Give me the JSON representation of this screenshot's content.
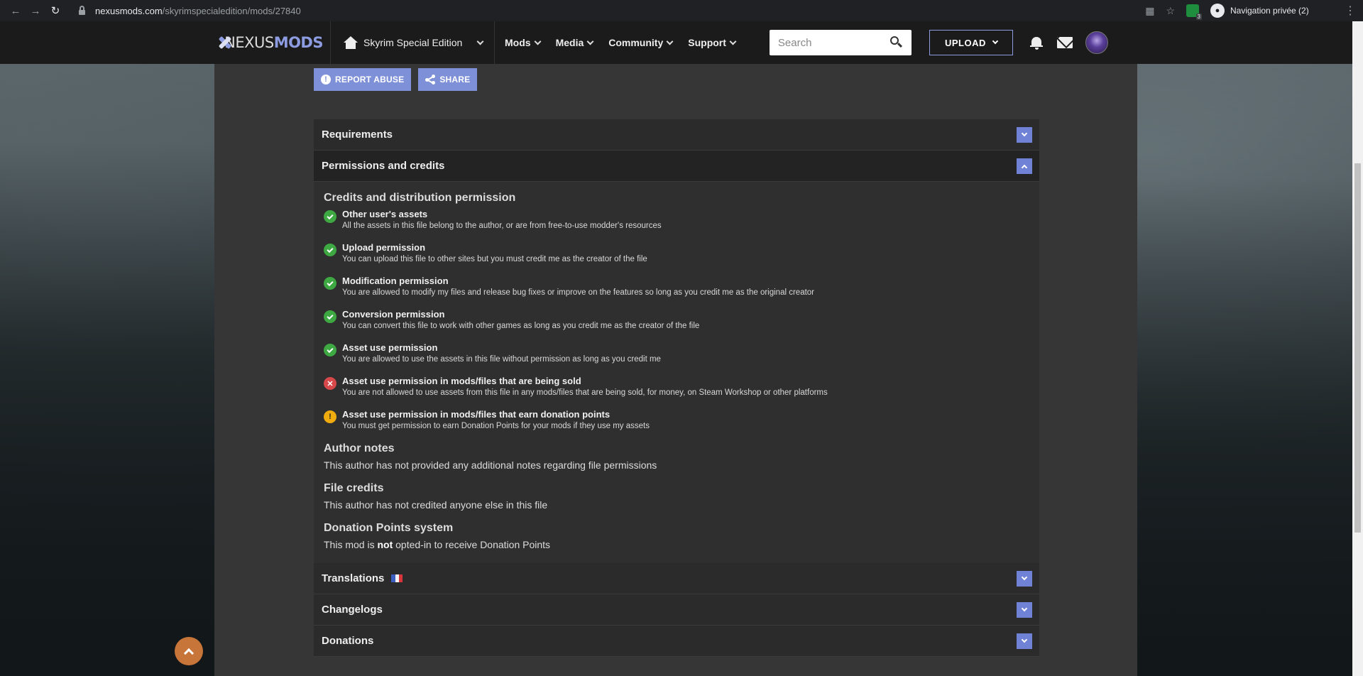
{
  "browser": {
    "url_domain": "nexusmods.com",
    "url_path": "/skyrimspecialedition/mods/27840",
    "extension_badge": "3",
    "profile_label": "Navigation privée (2)"
  },
  "header": {
    "logo_prefix": "NEXUS",
    "logo_suffix": "MODS",
    "game": "Skyrim Special Edition",
    "nav": [
      "Mods",
      "Media",
      "Community",
      "Support"
    ],
    "search_placeholder": "Search",
    "upload_label": "UPLOAD"
  },
  "actions": {
    "report": "REPORT ABUSE",
    "share": "SHARE"
  },
  "tabs": {
    "requirements": "Requirements",
    "permissions": "Permissions and credits",
    "translations": "Translations",
    "changelogs": "Changelogs",
    "donations": "Donations"
  },
  "permissions": {
    "heading": "Credits and distribution permission",
    "items": [
      {
        "status": "ok",
        "title": "Other user's assets",
        "desc": "All the assets in this file belong to the author, or are from free-to-use modder's resources"
      },
      {
        "status": "ok",
        "title": "Upload permission",
        "desc": "You can upload this file to other sites but you must credit me as the creator of the file"
      },
      {
        "status": "ok",
        "title": "Modification permission",
        "desc": "You are allowed to modify my files and release bug fixes or improve on the features so long as you credit me as the original creator"
      },
      {
        "status": "ok",
        "title": "Conversion permission",
        "desc": "You can convert this file to work with other games as long as you credit me as the creator of the file"
      },
      {
        "status": "ok",
        "title": "Asset use permission",
        "desc": "You are allowed to use the assets in this file without permission as long as you credit me"
      },
      {
        "status": "no",
        "title": "Asset use permission in mods/files that are being sold",
        "desc": "You are not allowed to use assets from this file in any mods/files that are being sold, for money, on Steam Workshop or other platforms"
      },
      {
        "status": "warn",
        "title": "Asset use permission in mods/files that earn donation points",
        "desc": "You must get permission to earn Donation Points for your mods if they use my assets"
      }
    ],
    "author_notes_title": "Author notes",
    "author_notes_text": "This author has not provided any additional notes regarding file permissions",
    "file_credits_title": "File credits",
    "file_credits_text": "This author has not credited anyone else in this file",
    "dp_title": "Donation Points system",
    "dp_pre": "This mod is ",
    "dp_bold": "not",
    "dp_post": " opted-in to receive Donation Points"
  },
  "colors": {
    "accent": "#7e90d8",
    "ok": "#3ea843",
    "no": "#d6484a",
    "warn": "#f0ac0f"
  }
}
